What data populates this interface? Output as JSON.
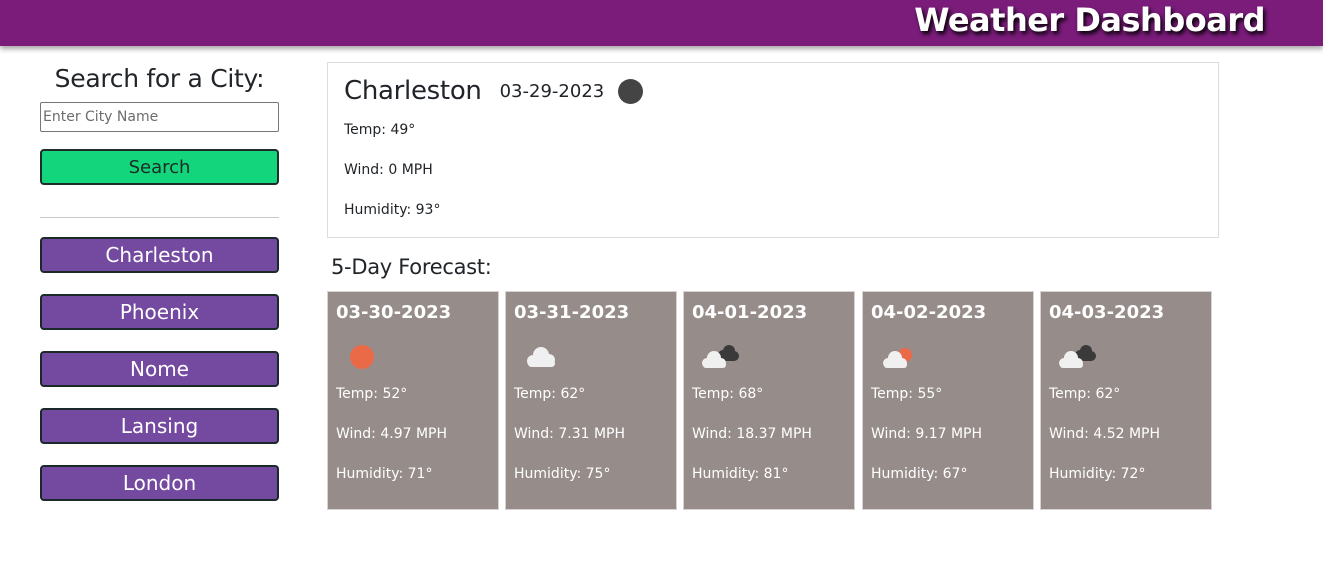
{
  "header": {
    "title": "Weather Dashboard",
    "background": "#7b1c7b"
  },
  "search": {
    "heading": "Search for a City:",
    "placeholder": "Enter City Name",
    "value": "",
    "button_label": "Search",
    "button_color": "#13d67c"
  },
  "history": {
    "button_color": "#744aa0",
    "cities": [
      "Charleston",
      "Phoenix",
      "Nome",
      "Lansing",
      "London"
    ]
  },
  "current": {
    "city": "Charleston",
    "date": "03-29-2023",
    "icon": "moon-icon",
    "temp": "Temp: 49°",
    "wind": "Wind: 0 MPH",
    "humidity": "Humidity: 93°"
  },
  "forecast": {
    "heading": "5-Day Forecast:",
    "card_color": "#968c8a",
    "days": [
      {
        "date": "03-30-2023",
        "icon": "sun-icon",
        "temp": "Temp: 52°",
        "wind": "Wind: 4.97 MPH",
        "humidity": "Humidity: 71°"
      },
      {
        "date": "03-31-2023",
        "icon": "cloud-icon",
        "temp": "Temp: 62°",
        "wind": "Wind: 7.31 MPH",
        "humidity": "Humidity: 75°"
      },
      {
        "date": "04-01-2023",
        "icon": "broken-clouds-icon",
        "temp": "Temp: 68°",
        "wind": "Wind: 18.37 MPH",
        "humidity": "Humidity: 81°"
      },
      {
        "date": "04-02-2023",
        "icon": "partly-cloudy-icon",
        "temp": "Temp: 55°",
        "wind": "Wind: 9.17 MPH",
        "humidity": "Humidity: 67°"
      },
      {
        "date": "04-03-2023",
        "icon": "broken-clouds-icon",
        "temp": "Temp: 62°",
        "wind": "Wind: 4.52 MPH",
        "humidity": "Humidity: 72°"
      }
    ]
  }
}
